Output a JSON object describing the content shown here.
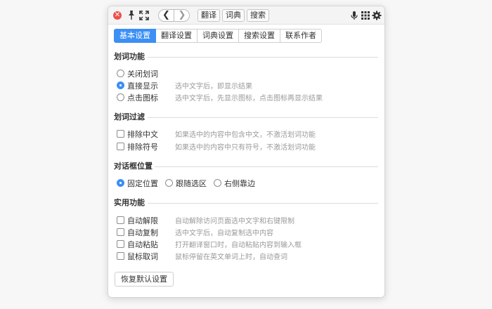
{
  "titlebar": {
    "close_symbol": "✕",
    "nav_back": "❮",
    "nav_forward": "❯",
    "tabs": [
      "翻译",
      "词典",
      "搜索"
    ]
  },
  "settings_tabs": [
    "基本设置",
    "翻译设置",
    "词典设置",
    "搜索设置",
    "联系作者"
  ],
  "sections": {
    "word_selection": {
      "title": "划词功能",
      "options": [
        {
          "label": "关闭划词",
          "desc": "",
          "checked": false
        },
        {
          "label": "直接显示",
          "desc": "选中文字后，即显示结果",
          "checked": true
        },
        {
          "label": "点击图标",
          "desc": "选中文字后，先显示图标，点击图标再显示结果",
          "checked": false
        }
      ]
    },
    "filter": {
      "title": "划词过滤",
      "options": [
        {
          "label": "排除中文",
          "desc": "如果选中的内容中包含中文，不激活划词功能"
        },
        {
          "label": "排除符号",
          "desc": "如果选中的内容中只有符号，不激活划词功能"
        }
      ]
    },
    "dialog_position": {
      "title": "对话框位置",
      "options": [
        {
          "label": "固定位置",
          "checked": true
        },
        {
          "label": "跟随选区",
          "checked": false
        },
        {
          "label": "右侧靠边",
          "checked": false
        }
      ]
    },
    "utility": {
      "title": "实用功能",
      "options": [
        {
          "label": "自动解限",
          "desc": "自动解除访问页面选中文字和右键限制"
        },
        {
          "label": "自动复制",
          "desc": "选中文字后，自动复制选中内容"
        },
        {
          "label": "自动粘贴",
          "desc": "打开翻译窗口时，自动粘贴内容到输入框"
        },
        {
          "label": "鼠标取词",
          "desc": "鼠标停留在英文单词上时，自动查词"
        }
      ]
    }
  },
  "reset_label": "恢复默认设置",
  "colors": {
    "accent": "#3b8ff5",
    "close": "#ef4f4f"
  }
}
